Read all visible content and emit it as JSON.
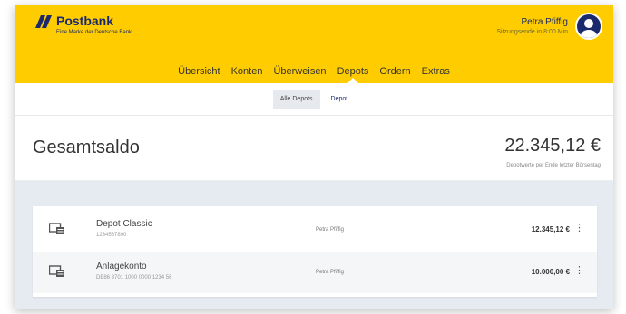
{
  "header": {
    "logo_name": "Postbank",
    "logo_tagline": "Eine Marke der Deutsche Bank",
    "user_name": "Petra Pfiffig",
    "session_text": "Sitzungsende in 8:00 Min"
  },
  "nav": {
    "items": [
      "Übersicht",
      "Konten",
      "Überweisen",
      "Depots",
      "Ordern",
      "Extras"
    ],
    "active": "Depots"
  },
  "subnav": {
    "items": [
      "Alle Depots",
      "Depot"
    ],
    "active": "Alle Depots"
  },
  "saldo": {
    "label": "Gesamtsaldo",
    "amount": "22.345,12 €",
    "note": "Depotwerte per Ende letzter Börsentag"
  },
  "depots": [
    {
      "title": "Depot Classic",
      "number": "1234567890",
      "owner": "Petra Pfiffig",
      "balance": "12.345,12 €",
      "icon": "depot-icon"
    },
    {
      "title": "Anlagekonto",
      "number": "DE86 3701 1000 0000 1234 56",
      "owner": "Petra Pfiffig",
      "balance": "10.000,00 €",
      "icon": "depot-icon"
    }
  ],
  "colors": {
    "brand_yellow": "#ffcc00",
    "brand_blue": "#1a2a6c",
    "list_background": "#e6ebf1"
  }
}
